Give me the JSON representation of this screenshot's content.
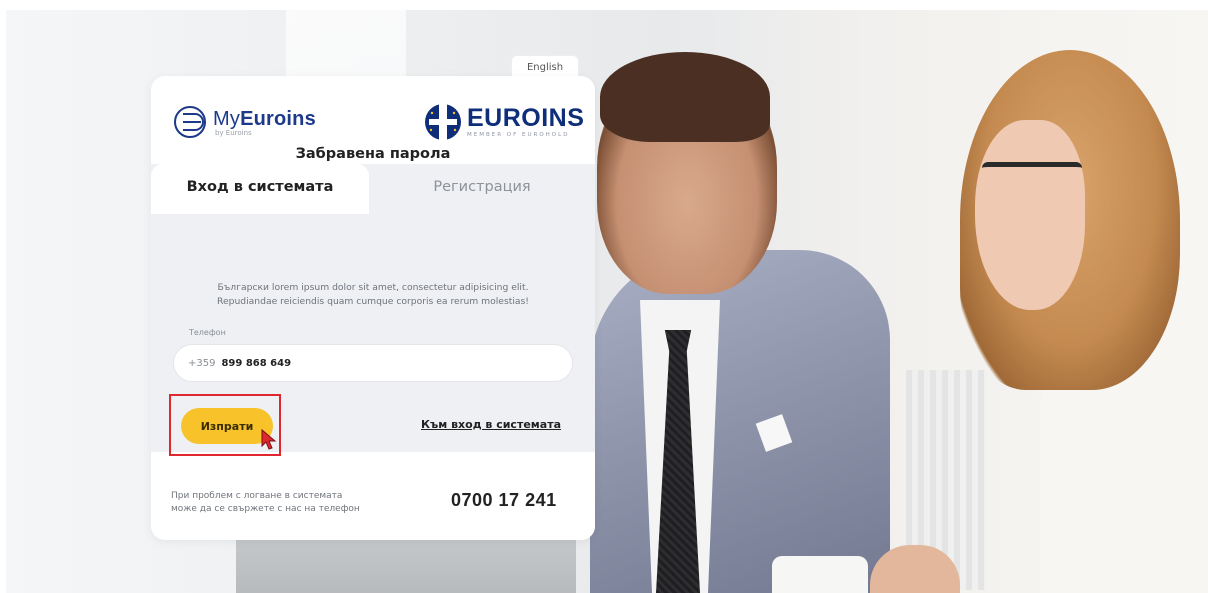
{
  "language_switch": "English",
  "logos": {
    "myeuroins_prefix": "My",
    "myeuroins_brand": "Euroins",
    "myeuroins_sub": "by Euroins",
    "euroins_word": "EUROINS",
    "euroins_tag": "MEMBER OF EUROHOLD"
  },
  "tabs": [
    {
      "label": "Вход в системата",
      "active": true
    },
    {
      "label": "Регистрация",
      "active": false
    }
  ],
  "form": {
    "title": "Забравена парола",
    "description_line1": "Български lorem ipsum dolor sit amet, consectetur adipisicing elit.",
    "description_line2": "Repudiandae reiciendis quam cumque corporis ea rerum molestias!",
    "phone_label": "Телефон",
    "phone_prefix": "+359",
    "phone_value": "899 868 649",
    "send_label": "Изпрати",
    "login_link": "Към вход в системата"
  },
  "footer": {
    "help_line1": "При проблем с логване в системата",
    "help_line2": "може да се свържете с нас на телефон",
    "hotline": "0700 17 241"
  },
  "colors": {
    "accent_yellow": "#f7c22a",
    "brand_blue": "#0f2e7a",
    "highlight_red": "#e0262e"
  }
}
